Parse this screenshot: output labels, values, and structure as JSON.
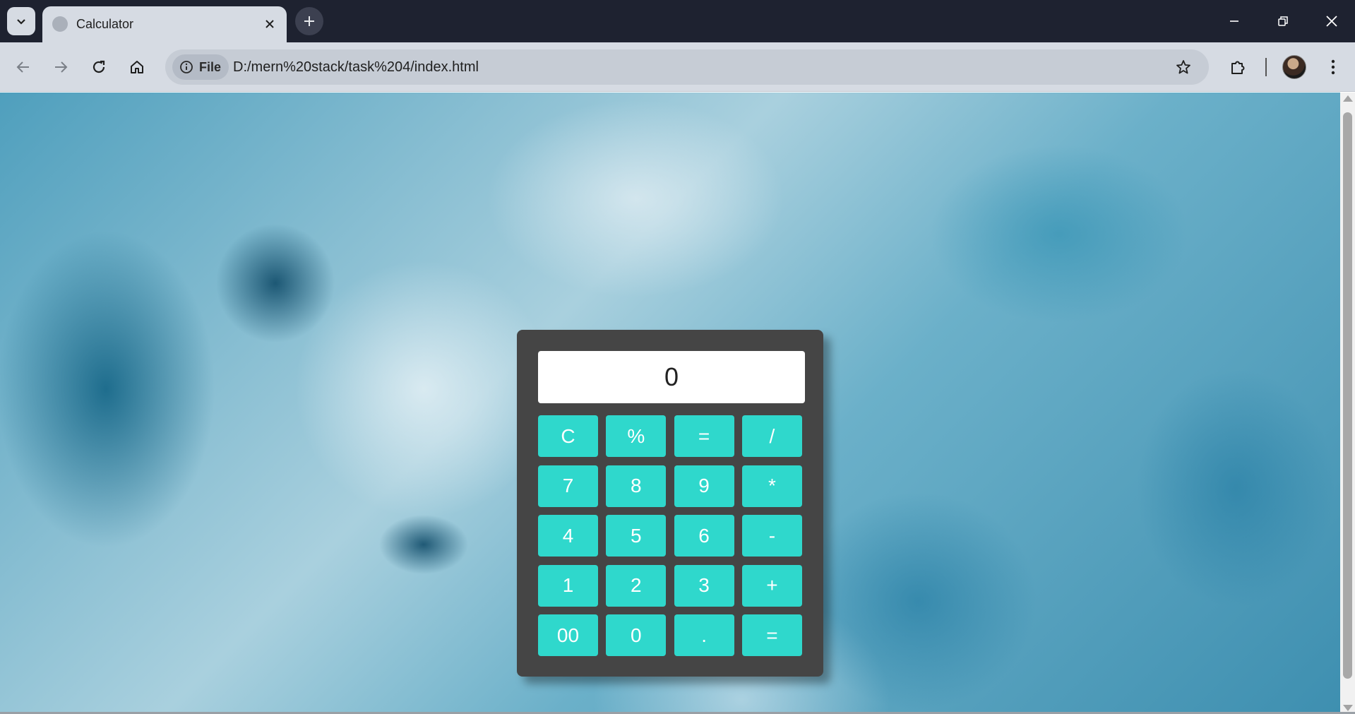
{
  "browser": {
    "tab_title": "Calculator",
    "site_chip_label": "File",
    "url": "D:/mern%20stack/task%204/index.html",
    "icons": {
      "tab_search": "chevron-down-icon",
      "tab_close": "close-icon",
      "new_tab": "plus-icon",
      "minimize": "minimize-icon",
      "restore": "restore-icon",
      "close_window": "close-icon",
      "back": "arrow-left-icon",
      "forward": "arrow-right-icon",
      "reload": "reload-icon",
      "home": "home-icon",
      "site_info": "info-icon",
      "bookmark": "star-icon",
      "extensions": "puzzle-icon",
      "profile": "avatar",
      "menu": "kebab-menu-icon"
    }
  },
  "calculator": {
    "display_value": "0",
    "keys": [
      {
        "label": "C"
      },
      {
        "label": "%"
      },
      {
        "label": "="
      },
      {
        "label": "/"
      },
      {
        "label": "7"
      },
      {
        "label": "8"
      },
      {
        "label": "9"
      },
      {
        "label": "*"
      },
      {
        "label": "4"
      },
      {
        "label": "5"
      },
      {
        "label": "6"
      },
      {
        "label": "-"
      },
      {
        "label": "1"
      },
      {
        "label": "2"
      },
      {
        "label": "3"
      },
      {
        "label": "+"
      },
      {
        "label": "00"
      },
      {
        "label": "0"
      },
      {
        "label": "."
      },
      {
        "label": "="
      }
    ]
  },
  "colors": {
    "calculator_body": "#454545",
    "key_background": "#2fd8cc",
    "key_text": "#ffffff",
    "display_background": "#ffffff"
  }
}
